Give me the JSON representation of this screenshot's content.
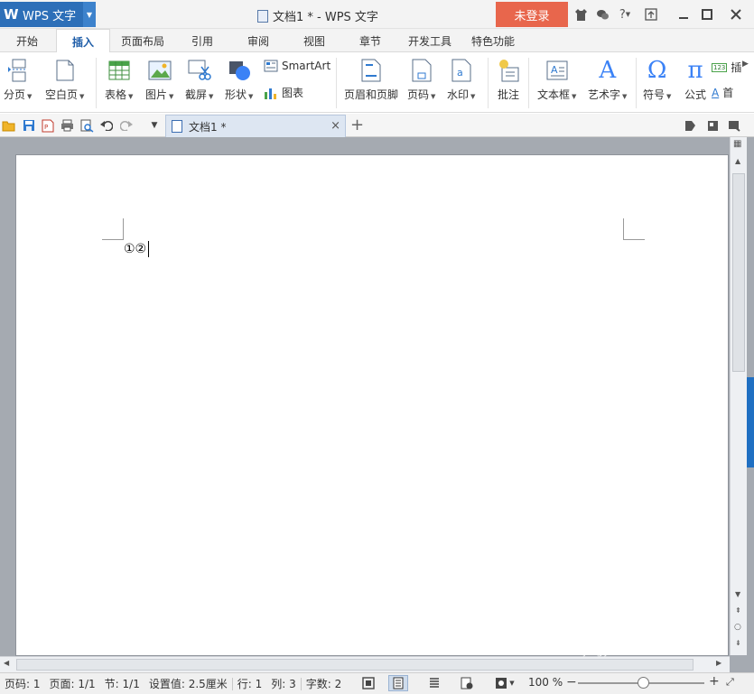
{
  "titlebar": {
    "app_button": "WPS 文字",
    "window_title": "文档1 * - WPS 文字",
    "login_button": "未登录"
  },
  "menu": {
    "tabs": [
      "开始",
      "插入",
      "页面布局",
      "引用",
      "审阅",
      "视图",
      "章节",
      "开发工具",
      "特色功能"
    ],
    "active_tab": "插入"
  },
  "ribbon": {
    "page_break": "分页",
    "blank_page": "空白页",
    "table": "表格",
    "picture": "图片",
    "screenshot": "截屏",
    "shape": "形状",
    "smartart": "SmartArt",
    "chart": "图表",
    "header_footer": "页眉和页脚",
    "page_number": "页码",
    "watermark": "水印",
    "comment": "批注",
    "textbox": "文本框",
    "wordart": "艺术字",
    "symbol": "符号",
    "formula": "公式",
    "insert_number": "插",
    "first_letter": "首"
  },
  "doc_tab": {
    "title": "文档1 *",
    "close": "×",
    "new_tab": "+"
  },
  "document": {
    "content": "①②"
  },
  "status": {
    "page_number": "页码: 1",
    "page": "页面: 1/1",
    "section": "节: 1/1",
    "setting": "设置值: 2.5厘米",
    "row": "行: 1",
    "column": "列: 3",
    "word_count": "字数: 2",
    "zoom": "100 %"
  },
  "watermark_overlay": {
    "brand": "Bai 经验",
    "url": "jingyan.baidu.com"
  }
}
